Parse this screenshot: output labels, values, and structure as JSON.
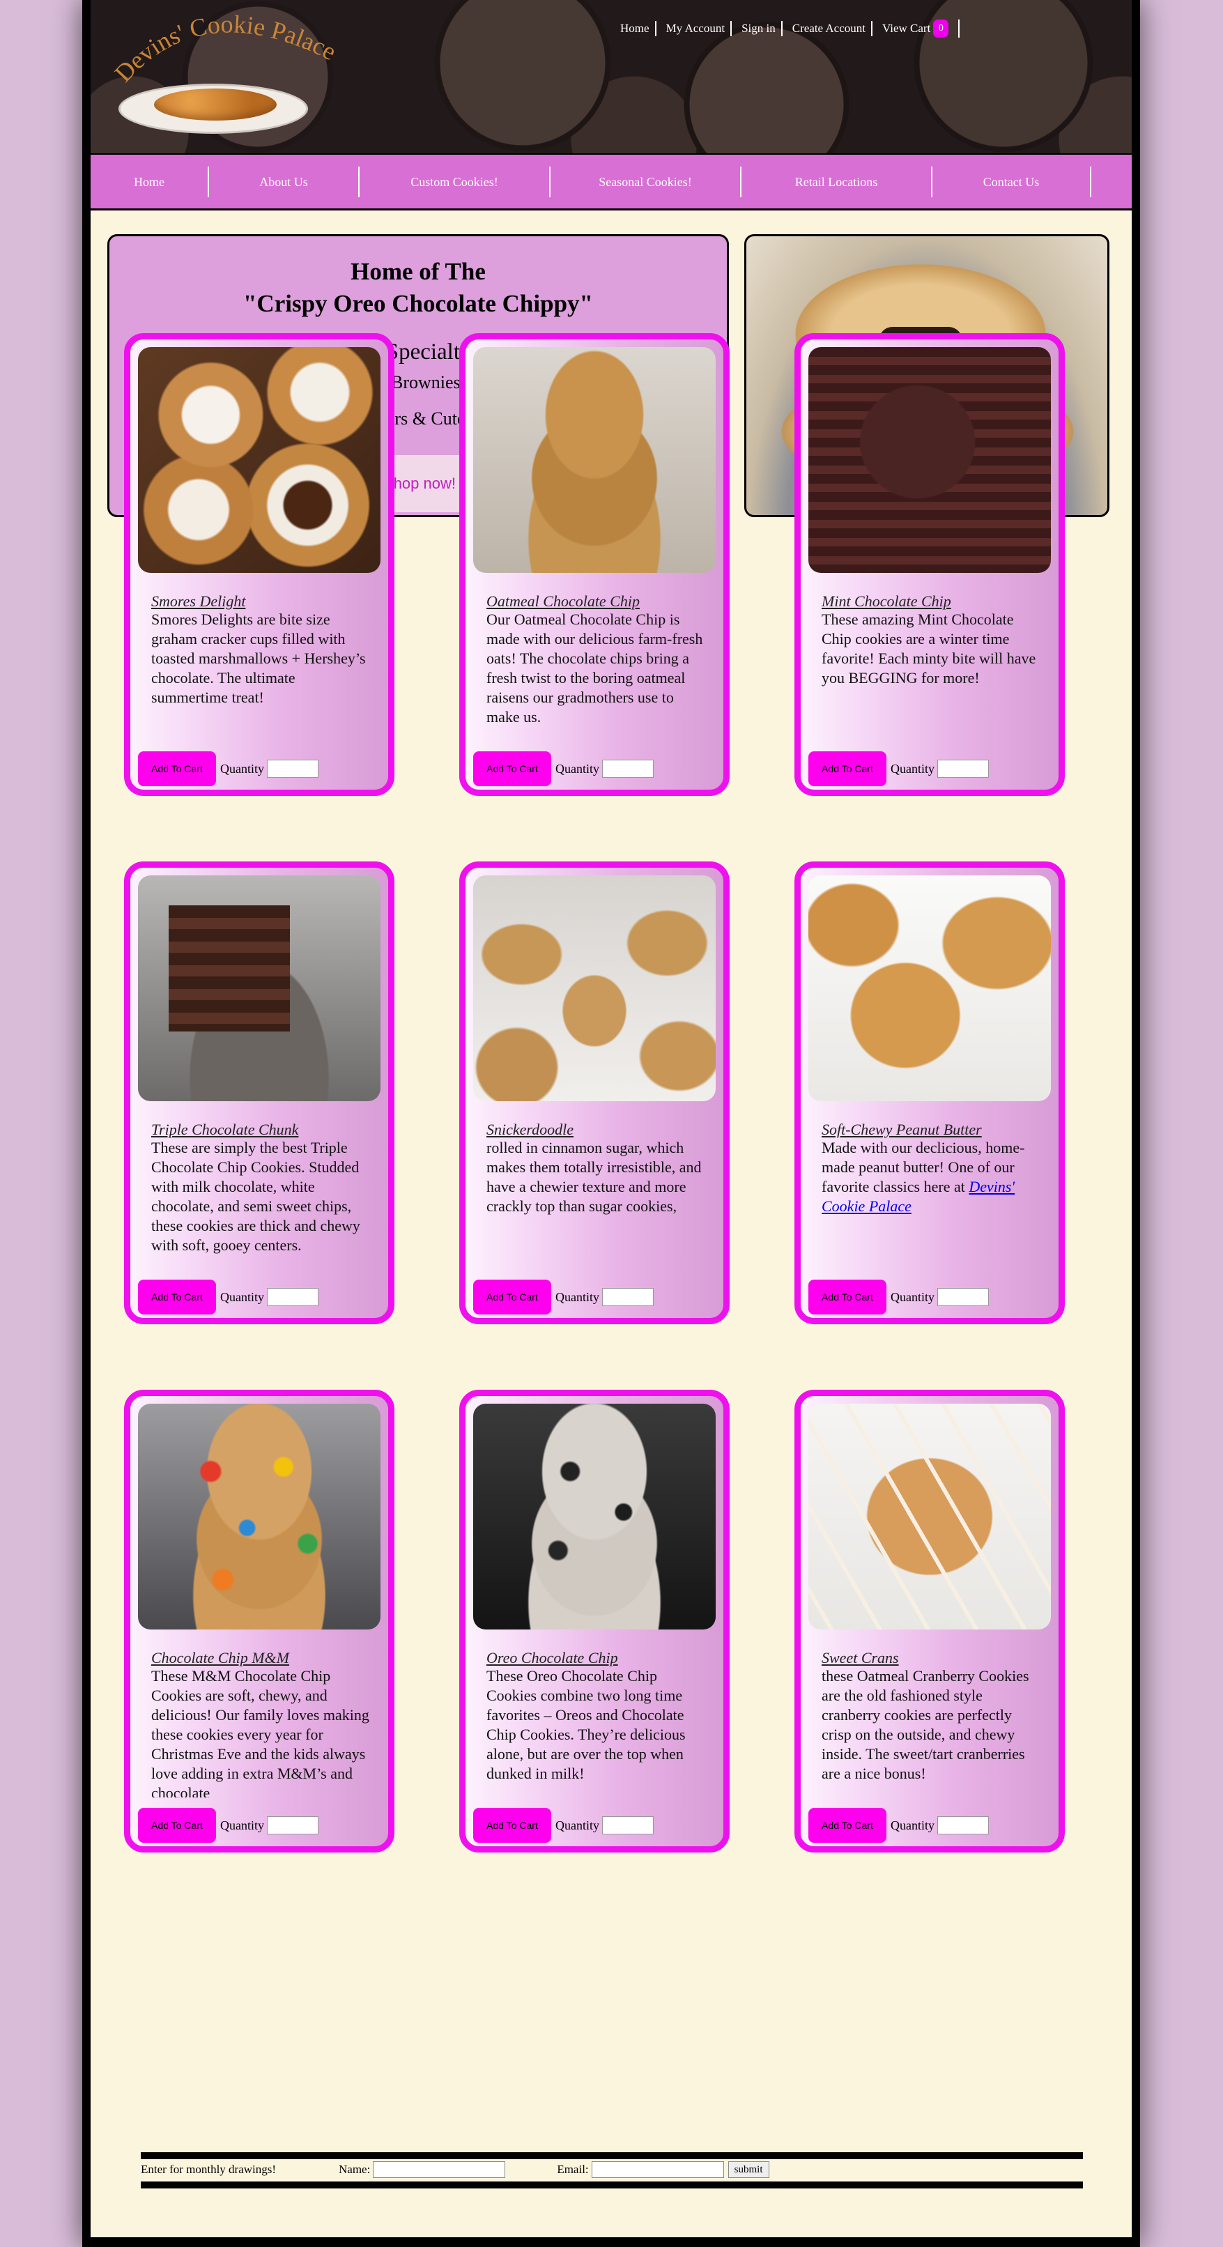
{
  "header": {
    "logo_text": "Devins' Cookie Palace",
    "nav": [
      "Home",
      "My Account",
      "Sign in",
      "Create Account",
      "View Cart"
    ],
    "cart_count": "0"
  },
  "mainnav": [
    "Home",
    "About Us",
    "Custom Cookies!",
    "Seasonal Cookies!",
    "Retail Locations",
    "Contact Us"
  ],
  "hero": {
    "title_line1": "Home of The",
    "title_line2": "\"Crispy Oreo Chocolate Chippy\"",
    "specialties_title": "Our Specialties:",
    "specialties_line1": "Cookies/ Brownies/ Cakes",
    "specialties_line2": "Party Trays/ Custom Orders & Cutouts/ Seasonal Cookies!",
    "shop_button": "Shop now!"
  },
  "products": [
    {
      "name": "Smores Delight",
      "desc": "Smores Delights are bite size graham cracker cups filled with toasted marshmallows + Hershey’s chocolate. The ultimate summertime treat!",
      "brand": ""
    },
    {
      "name": "Oatmeal Chocolate Chip",
      "desc": "Our Oatmeal Chocolate Chip is made with our delicious farm-fresh oats! The chocolate chips bring a fresh twist to the boring oatmeal raisens our gradmothers use to make us.",
      "brand": ""
    },
    {
      "name": "Mint Chocolate Chip",
      "desc": "These amazing Mint Chocolate Chip cookies are a winter time favorite! Each minty bite will have you BEGGING for more!",
      "brand": ""
    },
    {
      "name": "Triple Chocolate Chunk",
      "desc": "These are simply the best Triple Chocolate Chip Cookies. Studded with milk chocolate, white chocolate, and semi sweet chips, these cookies are thick and chewy with soft, gooey centers.",
      "brand": ""
    },
    {
      "name": "Snickerdoodle",
      "desc": "rolled in cinnamon sugar, which makes them totally irresistible, and have a chewier texture and more crackly top than sugar cookies,",
      "brand": ""
    },
    {
      "name": "Soft-Chewy Peanut Butter",
      "desc": "Made with our declicious, home-made peanut butter! One of our favorite classics here at",
      "brand": "Devins' Cookie Palace"
    },
    {
      "name": "Chocolate Chip M&M",
      "desc": "These M&M Chocolate Chip Cookies are soft, chewy, and delicious! Our family loves making these cookies every year for Christmas Eve and the kids always love adding in extra M&M’s and chocolate",
      "brand": ""
    },
    {
      "name": "Oreo Chocolate Chip",
      "desc": "These Oreo Chocolate Chip Cookies combine two long time favorites – Oreos and Chocolate Chip Cookies. They’re delicious alone, but are over the top when dunked in milk!",
      "brand": ""
    },
    {
      "name": "Sweet Crans",
      "desc": "these Oatmeal Cranberry Cookies are the old fashioned style cranberry cookies are perfectly crisp on the outside, and chewy inside. The sweet/tart cranberries are a nice bonus!",
      "brand": ""
    }
  ],
  "card_labels": {
    "add_to_cart": "Add To Cart",
    "quantity": "Quantity"
  },
  "footer": {
    "drawing_text": "Enter for monthly drawings!",
    "name_label": "Name:",
    "email_label": "Email:",
    "submit": "submit"
  },
  "colors": {
    "nav_bg": "#d86fd4",
    "card_border": "#ee11ee",
    "button_magenta": "#ff00ee",
    "page_bg": "#fcf5dd"
  }
}
